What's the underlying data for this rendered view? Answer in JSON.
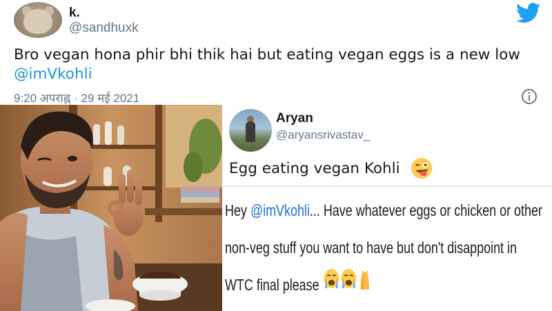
{
  "tweet_main": {
    "author_name": "k.",
    "author_handle": "@sandhuxk",
    "text_part1": "Bro vegan hona phir bhi thik hai but eating vegan eggs is a new low ",
    "mention": "@imVkohli",
    "timestamp": "9:20 अपराह्न · 29 मई 2021",
    "icons": {
      "brand": "twitter-bird-icon",
      "info": "info-icon"
    },
    "colors": {
      "link": "#1b95e0",
      "meta": "#657786",
      "brand": "#1da1f2"
    }
  },
  "photo": {
    "subject": "man winking with OK hand sign, coffee cup"
  },
  "tweet_reply": {
    "author_name": "Aryan",
    "author_handle": "@aryansrivastav_",
    "text": "Egg eating vegan Kohli",
    "emoji": "winking-face-with-tongue-icon"
  },
  "quote": {
    "prefix": "Hey ",
    "mention": "@imVkohli",
    "line1_rest": "... Have whatever eggs or chicken or other",
    "line2": "non-veg stuff you want to have but don't disappoint in",
    "line3": "WTC final please",
    "emojis": [
      "crying-face-icon",
      "crying-face-icon",
      "folded-hands-icon"
    ]
  }
}
